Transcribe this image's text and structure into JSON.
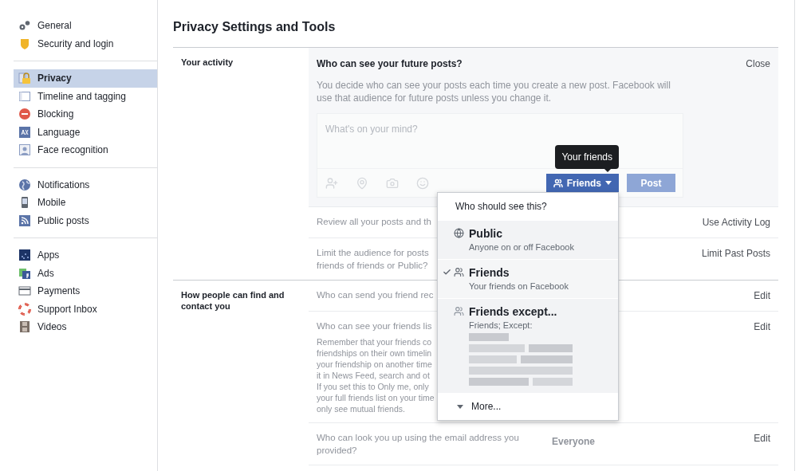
{
  "sidebar": {
    "groups": [
      [
        {
          "label": "General",
          "kind": "gears",
          "selected": false
        },
        {
          "label": "Security and login",
          "kind": "shield",
          "selected": false
        }
      ],
      [
        {
          "label": "Privacy",
          "kind": "lock",
          "selected": true
        },
        {
          "label": "Timeline and tagging",
          "kind": "timeline",
          "selected": false
        },
        {
          "label": "Blocking",
          "kind": "blocking",
          "selected": false
        },
        {
          "label": "Language",
          "kind": "language",
          "selected": false
        },
        {
          "label": "Face recognition",
          "kind": "face",
          "selected": false
        }
      ],
      [
        {
          "label": "Notifications",
          "kind": "globe",
          "selected": false
        },
        {
          "label": "Mobile",
          "kind": "mobile",
          "selected": false
        },
        {
          "label": "Public posts",
          "kind": "rss",
          "selected": false
        }
      ],
      [
        {
          "label": "Apps",
          "kind": "apps",
          "selected": false
        },
        {
          "label": "Ads",
          "kind": "ads",
          "selected": false
        },
        {
          "label": "Payments",
          "kind": "payments",
          "selected": false
        },
        {
          "label": "Support Inbox",
          "kind": "support",
          "selected": false
        },
        {
          "label": "Videos",
          "kind": "videos",
          "selected": false
        }
      ]
    ]
  },
  "page_title": "Privacy Settings and Tools",
  "sections": [
    {
      "label": "Your activity",
      "open_setting": {
        "title": "Who can see your future posts?",
        "close": "Close",
        "description": "You decide who can see your posts each time you create a new post. Facebook will use that audience for future posts unless you change it.",
        "composer": {
          "placeholder": "What's on your mind?",
          "audience_button": "Friends",
          "tooltip": "Your friends",
          "post_button": {
            "label": "Post",
            "disabled": true
          }
        },
        "audience_menu": {
          "header": "Who should see this?",
          "options": [
            {
              "kind": "globe",
              "label": "Public",
              "sublabel": "Anyone on or off Facebook",
              "selected": false
            },
            {
              "kind": "friends",
              "label": "Friends",
              "sublabel": "Your friends on Facebook",
              "selected": true
            },
            {
              "kind": "friends-except",
              "label": "Friends except...",
              "sublabel": "Friends; Except:",
              "selected": false
            }
          ],
          "more": "More..."
        }
      },
      "rows": [
        {
          "lines": [
            "Review all your posts and th"
          ],
          "action": "Use Activity Log"
        },
        {
          "lines": [
            "Limit the audience for posts",
            "friends of friends or Public?"
          ],
          "action": "Limit Past Posts"
        }
      ]
    },
    {
      "label": "How people can find and contact you",
      "rows": [
        {
          "lines": [
            "Who can send you friend rec"
          ],
          "action": "Edit"
        },
        {
          "lines": [
            "Who can see your friends lis"
          ],
          "note_lines": [
            "Remember that your friends co",
            "friendships on their own timelin",
            "your friendship on another time",
            "it in News Feed, search and ot",
            "If you set this to Only me, only",
            "your full friends list on your time",
            "only see mutual friends."
          ],
          "action": "Edit"
        },
        {
          "lines": [
            "Who can look you up using the email address you",
            "provided?"
          ],
          "value": "Everyone",
          "action": "Edit"
        }
      ]
    }
  ]
}
